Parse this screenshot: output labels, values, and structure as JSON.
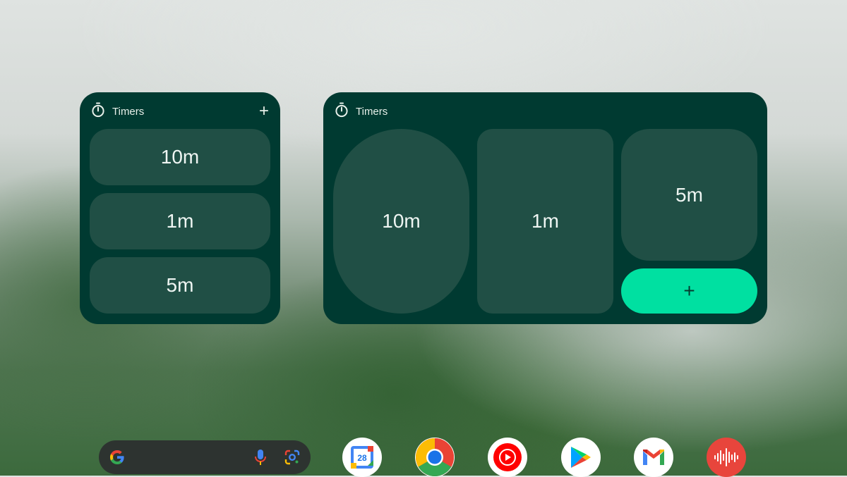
{
  "small_widget": {
    "title": "Timers",
    "add_label": "+",
    "timers": [
      "10m",
      "1m",
      "5m"
    ]
  },
  "large_widget": {
    "title": "Timers",
    "timers": [
      "10m",
      "1m",
      "5m"
    ],
    "add_label": "+"
  },
  "dock": {
    "search_icons": [
      "google-g-icon",
      "microphone-icon",
      "google-lens-icon"
    ],
    "calendar_day": "28",
    "apps": [
      "calendar",
      "chrome",
      "youtube-music",
      "play-store",
      "gmail",
      "recorder"
    ]
  },
  "colors": {
    "widget_bg": "#003a31",
    "timer_bg": "#204f45",
    "accent": "#00e0a1"
  }
}
